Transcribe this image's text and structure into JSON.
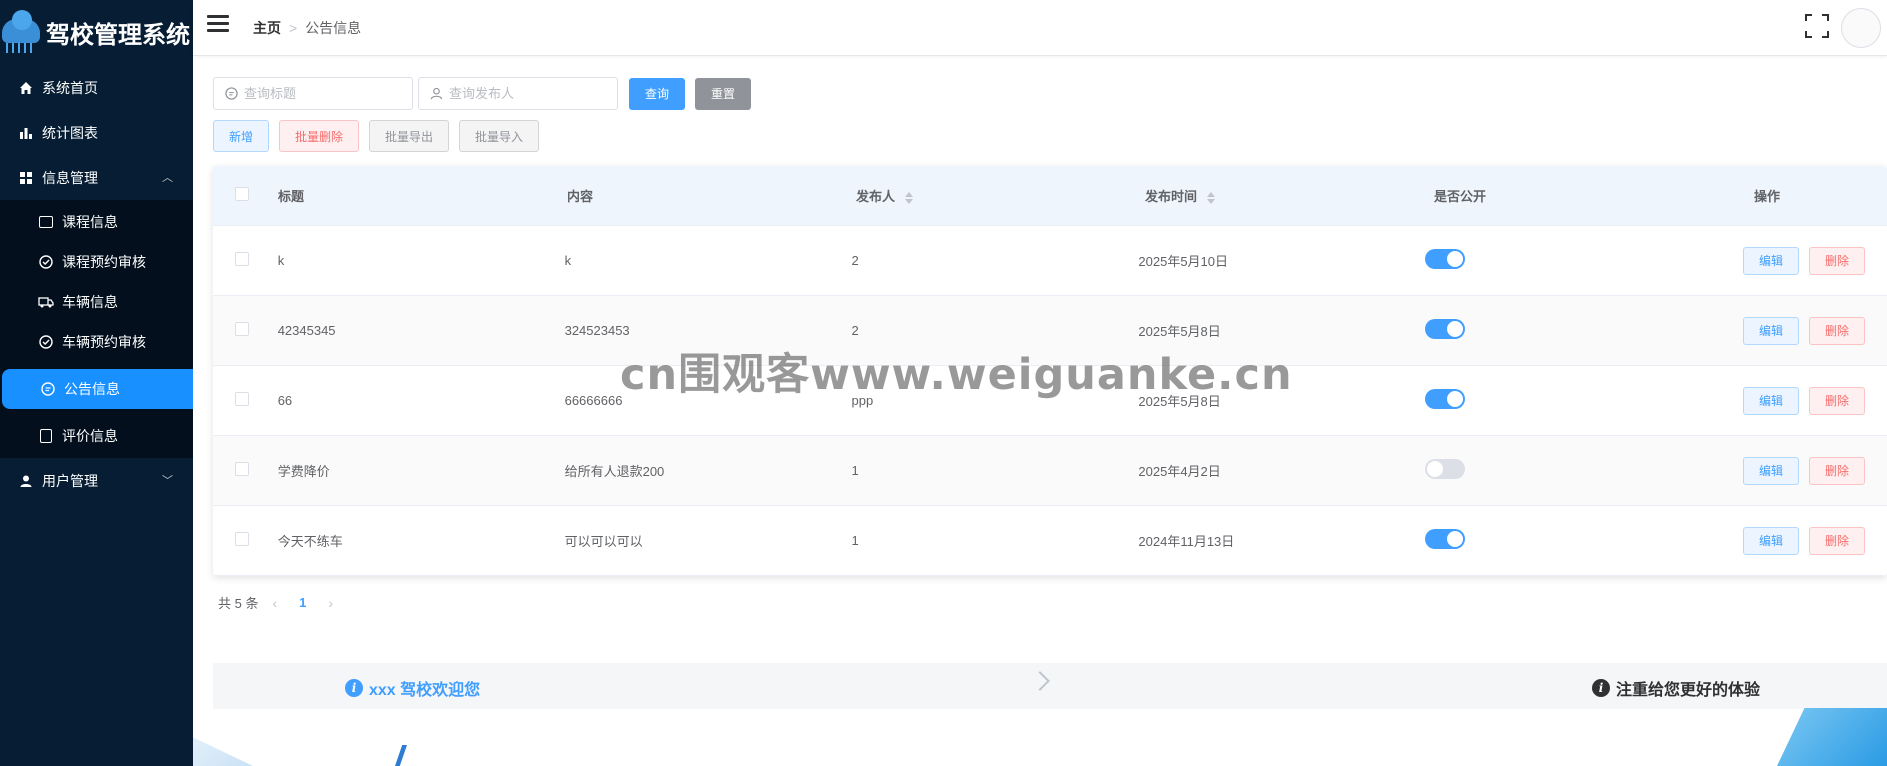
{
  "app": {
    "title": "驾校管理系统"
  },
  "sidebar": {
    "items": [
      {
        "label": "系统首页",
        "icon": "home-icon"
      },
      {
        "label": "统计图表",
        "icon": "bar-chart-icon"
      },
      {
        "label": "信息管理",
        "icon": "grid-icon",
        "expanded": true
      },
      {
        "label": "用户管理",
        "icon": "user-icon",
        "expanded": false
      }
    ],
    "info_submenu": [
      {
        "label": "课程信息",
        "icon": "course-icon"
      },
      {
        "label": "课程预约审核",
        "icon": "check-circle-icon"
      },
      {
        "label": "车辆信息",
        "icon": "truck-icon"
      },
      {
        "label": "车辆预约审核",
        "icon": "check-circle-icon"
      },
      {
        "label": "公告信息",
        "icon": "message-icon",
        "active": true
      },
      {
        "label": "评价信息",
        "icon": "document-icon"
      }
    ]
  },
  "header": {
    "breadcrumb": {
      "home": "主页",
      "separator": ">",
      "current": "公告信息"
    }
  },
  "search": {
    "title_placeholder": "查询标题",
    "publisher_placeholder": "查询发布人",
    "query_label": "查询",
    "reset_label": "重置"
  },
  "actions": {
    "add_label": "新增",
    "batch_delete_label": "批量删除",
    "batch_export_label": "批量导出",
    "batch_import_label": "批量导入"
  },
  "table": {
    "columns": {
      "title": "标题",
      "content": "内容",
      "publisher": "发布人",
      "publish_time": "发布时间",
      "is_public": "是否公开",
      "operation": "操作"
    },
    "edit_label": "编辑",
    "delete_label": "删除",
    "rows": [
      {
        "title": "k",
        "content": "k",
        "publisher": "2",
        "publish_time": "2025年5月10日",
        "is_public": true
      },
      {
        "title": "42345345",
        "content": "324523453",
        "publisher": "2",
        "publish_time": "2025年5月8日",
        "is_public": true
      },
      {
        "title": "66",
        "content": "66666666",
        "publisher": "ppp",
        "publish_time": "2025年5月8日",
        "is_public": true
      },
      {
        "title": "学费降价",
        "content": "给所有人退款200",
        "publisher": "1",
        "publish_time": "2025年4月2日",
        "is_public": false
      },
      {
        "title": "今天不练车",
        "content": "可以可以可以",
        "publisher": "1",
        "publish_time": "2024年11月13日",
        "is_public": true
      }
    ]
  },
  "pagination": {
    "total_text": "共 5 条",
    "current_page": "1",
    "prev": "‹",
    "next": "›"
  },
  "notice": {
    "left_text": "xxx 驾校欢迎您",
    "right_text": "注重给您更好的体验",
    "info_glyph": "i"
  },
  "watermark": "cn围观客www.weiguanke.cn",
  "colors": {
    "primary": "#409eff",
    "sidebar_bg": "#061d33",
    "danger": "#f56c6c",
    "active_menu": "#1890ff"
  }
}
